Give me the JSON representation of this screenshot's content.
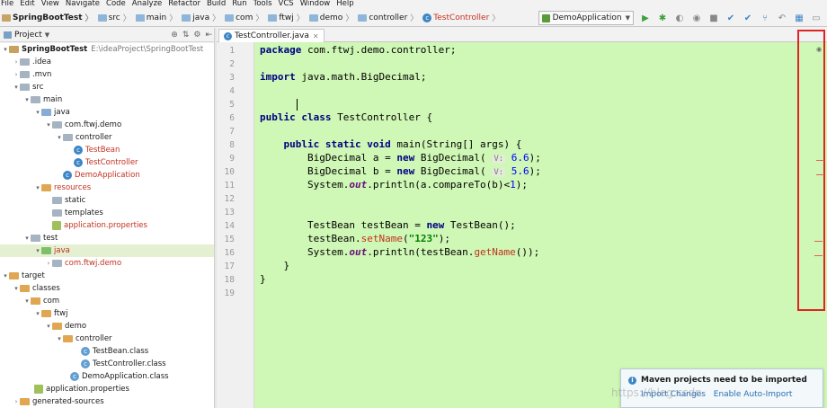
{
  "menu": [
    "File",
    "Edit",
    "View",
    "Navigate",
    "Code",
    "Analyze",
    "Refactor",
    "Build",
    "Run",
    "Tools",
    "VCS",
    "Window",
    "Help"
  ],
  "breadcrumbs": [
    "SpringBootTest",
    "src",
    "main",
    "java",
    "com",
    "ftwj",
    "demo",
    "controller",
    "TestController"
  ],
  "run_config": "DemoApplication",
  "project_panel": {
    "title": "Project"
  },
  "tree": [
    {
      "label": "SpringBootTest",
      "path": "E:\\ideaProject\\SpringBootTest"
    },
    {
      "label": ".idea"
    },
    {
      "label": ".mvn"
    },
    {
      "label": "src"
    },
    {
      "label": "main"
    },
    {
      "label": "java"
    },
    {
      "label": "com.ftwj.demo"
    },
    {
      "label": "controller"
    },
    {
      "label": "TestBean"
    },
    {
      "label": "TestController"
    },
    {
      "label": "DemoApplication"
    },
    {
      "label": "resources"
    },
    {
      "label": "static"
    },
    {
      "label": "templates"
    },
    {
      "label": "application.properties"
    },
    {
      "label": "test"
    },
    {
      "label": "java"
    },
    {
      "label": "com.ftwj.demo"
    },
    {
      "label": "target"
    },
    {
      "label": "classes"
    },
    {
      "label": "com"
    },
    {
      "label": "ftwj"
    },
    {
      "label": "demo"
    },
    {
      "label": "controller"
    },
    {
      "label": "TestBean.class"
    },
    {
      "label": "TestController.class"
    },
    {
      "label": "DemoApplication.class"
    },
    {
      "label": "application.properties"
    },
    {
      "label": "generated-sources"
    }
  ],
  "editor_tab": "TestController.java",
  "line_numbers": [
    "1",
    "2",
    "3",
    "4",
    "5",
    "6",
    "7",
    "8",
    "9",
    "10",
    "11",
    "12",
    "13",
    "14",
    "15",
    "16",
    "17",
    "18",
    "19"
  ],
  "code": {
    "l1_kw": "package",
    "l1_rest": " com.ftwj.demo.controller;",
    "l3_kw": "import",
    "l3_rest": " java.math.BigDecimal;",
    "l6_kw": "public class",
    "l6_rest": " TestController {",
    "l8_kw": "public static void",
    "l8_rest": " main(String[] args) {",
    "l9_a": "BigDecimal a = ",
    "l9_new": "new",
    "l9_b": " BigDecimal(",
    "l9_hint": "V:",
    "l9_num": "6.6",
    "l9_end": ");",
    "l10_a": "BigDecimal b = ",
    "l10_new": "new",
    "l10_b": " BigDecimal(",
    "l10_hint": "V:",
    "l10_num": "5.6",
    "l10_end": ");",
    "l11_a": "System.",
    "l11_out": "out",
    "l11_b": ".println(a.compareTo(b)<",
    "l11_num": "1",
    "l11_end": ");",
    "l14_a": "TestBean testBean = ",
    "l14_new": "new",
    "l14_b": " TestBean();",
    "l15_a": "testBean.",
    "l15_m": "setName",
    "l15_b": "(",
    "l15_str": "\"123\"",
    "l15_end": ");",
    "l16_a": "System.",
    "l16_out": "out",
    "l16_b": ".println(testBean.",
    "l16_m": "getName",
    "l16_end": "());",
    "l17": "}",
    "l18": "}"
  },
  "notification": {
    "title": "Maven projects need to be imported",
    "link1": "Import Changes",
    "link2": "Enable Auto-Import"
  },
  "watermark": "https://blog.csdn"
}
